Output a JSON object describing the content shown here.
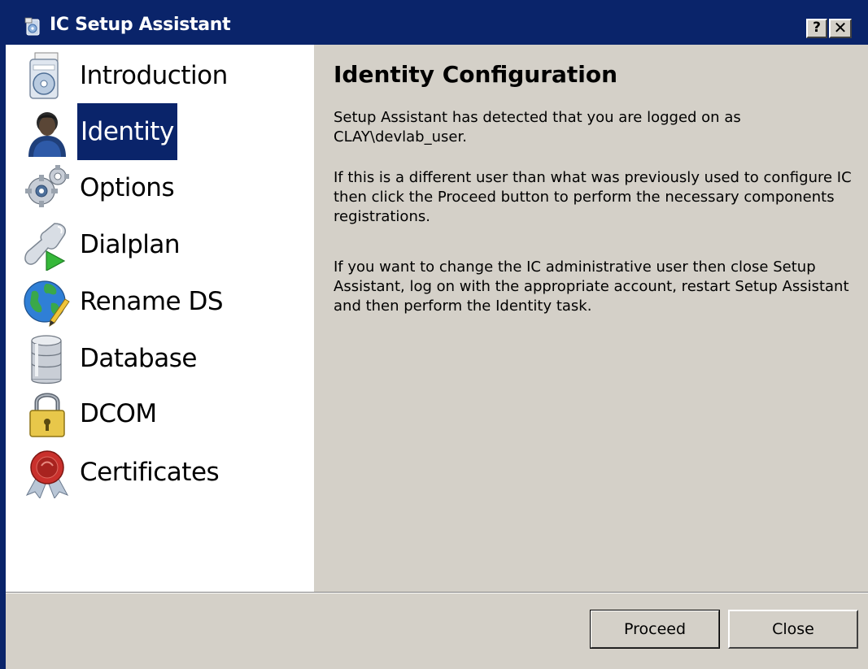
{
  "window": {
    "title": "IC Setup Assistant",
    "help_glyph": "?",
    "close_glyph": "✕"
  },
  "sidebar": {
    "items": [
      {
        "label": "Introduction",
        "icon": "setup-disc-icon",
        "selected": false
      },
      {
        "label": "Identity",
        "icon": "user-icon",
        "selected": true
      },
      {
        "label": "Options",
        "icon": "gear-icon",
        "selected": false
      },
      {
        "label": "Dialplan",
        "icon": "phone-icon",
        "selected": false
      },
      {
        "label": "Rename DS",
        "icon": "globe-pencil-icon",
        "selected": false
      },
      {
        "label": "Database",
        "icon": "database-icon",
        "selected": false
      },
      {
        "label": "DCOM",
        "icon": "lock-icon",
        "selected": false
      },
      {
        "label": "Certificates",
        "icon": "certificate-icon",
        "selected": false
      }
    ]
  },
  "content": {
    "heading": "Identity Configuration",
    "paragraphs": [
      "Setup Assistant has detected that you are logged on as CLAY\\devlab_user.",
      "If this is a different user than what was previously used to configure IC then click the Proceed button to perform the necessary components registrations.",
      "If you want to change the IC administrative user then close Setup Assistant, log on with the appropriate account, restart Setup Assistant and then perform the Identity task."
    ]
  },
  "buttons": {
    "proceed": "Proceed",
    "close": "Close"
  },
  "colors": {
    "titlebar": "#0a246a",
    "selection": "#0a246a",
    "face": "#d4d0c8",
    "sidebar_bg": "#ffffff"
  }
}
